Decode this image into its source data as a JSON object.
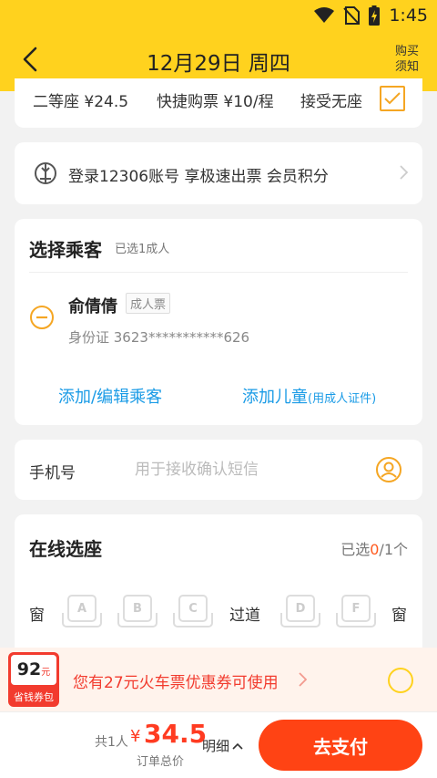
{
  "status_bar": {
    "time": "1:45"
  },
  "nav": {
    "title": "12月29日 周四",
    "buy_notice_line1": "购买",
    "buy_notice_line2": "须知"
  },
  "ticket_options": {
    "seat": "二等座 ¥24.5",
    "fast_buy": "快捷购票 ¥10/程",
    "accept_no_seat": "接受无座",
    "accept_no_seat_checked": true
  },
  "login_promo": {
    "text": "登录12306账号 享极速出票 会员积分"
  },
  "passengers": {
    "title": "选择乘客",
    "subtitle": "已选1成人",
    "items": [
      {
        "name": "俞倩倩",
        "type": "成人票",
        "id_text": "身份证 3623***********626"
      }
    ],
    "add_edit_label": "添加/编辑乘客",
    "add_child_label": "添加儿童",
    "add_child_hint": "(用成人证件)"
  },
  "phone": {
    "label": "手机号",
    "placeholder": "用于接收确认短信",
    "value": ""
  },
  "seat_selection": {
    "title": "在线选座",
    "count_prefix": "已选",
    "count_selected": "0",
    "count_suffix": "/1个",
    "window_label": "窗",
    "aisle_label": "过道",
    "seats_left": [
      "A",
      "B",
      "C"
    ],
    "seats_right": [
      "D",
      "F"
    ]
  },
  "coupon": {
    "badge_amount": "92",
    "badge_unit": "元",
    "badge_label": "省钱券包",
    "text": "您有27元火车票优惠券可使用",
    "colors": {
      "red": "#f23b2e",
      "yellow": "#ffd21e"
    }
  },
  "bottom": {
    "total_prefix": "共1人",
    "currency": "¥",
    "total_amount": "34.5",
    "total_label": "订单总价",
    "detail_label": "明细",
    "pay_label": "去支付",
    "colors": {
      "accent": "#ff4314"
    }
  }
}
